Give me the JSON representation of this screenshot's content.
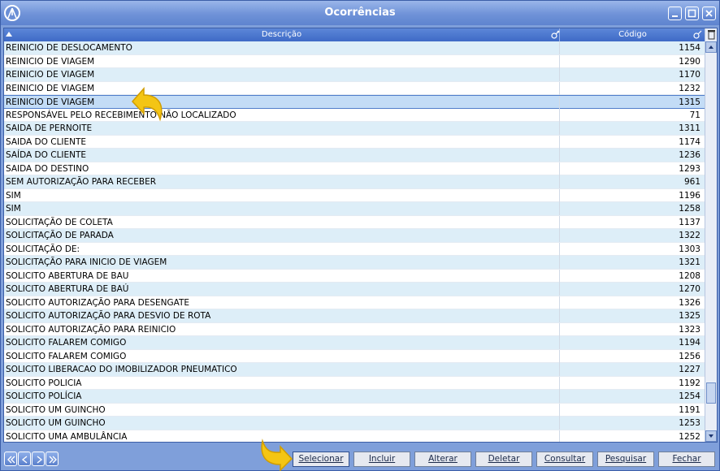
{
  "window": {
    "title": "Ocorrências",
    "controls": [
      "minimize",
      "maximize",
      "close"
    ]
  },
  "grid": {
    "columns": [
      "Descrição",
      "Código"
    ],
    "selected_index": 4,
    "rows": [
      {
        "descricao": "REINICIO DE DESLOCAMENTO",
        "codigo": "1154"
      },
      {
        "descricao": "REINICIO DE VIAGEM",
        "codigo": "1290"
      },
      {
        "descricao": "REINICIO DE VIAGEM",
        "codigo": "1170"
      },
      {
        "descricao": "REINICIO DE VIAGEM",
        "codigo": "1232"
      },
      {
        "descricao": "REINICIO DE VIAGEM",
        "codigo": "1315"
      },
      {
        "descricao": "RESPONSÁVEL PELO RECEBIMENTO NÃO LOCALIZADO",
        "codigo": "71"
      },
      {
        "descricao": "SAIDA DE PERNOITE",
        "codigo": "1311"
      },
      {
        "descricao": "SAIDA DO CLIENTE",
        "codigo": "1174"
      },
      {
        "descricao": "SAÍDA DO CLIENTE",
        "codigo": "1236"
      },
      {
        "descricao": "SAIDA DO DESTINO",
        "codigo": "1293"
      },
      {
        "descricao": "SEM AUTORIZAÇÃO PARA RECEBER",
        "codigo": "961"
      },
      {
        "descricao": "SIM",
        "codigo": "1196"
      },
      {
        "descricao": "SIM",
        "codigo": "1258"
      },
      {
        "descricao": "SOLICITAÇÃO DE COLETA",
        "codigo": "1137"
      },
      {
        "descricao": "SOLICITAÇÃO DE PARADA",
        "codigo": "1322"
      },
      {
        "descricao": "SOLICITAÇÃO DE:",
        "codigo": "1303"
      },
      {
        "descricao": "SOLICITAÇÃO PARA INICIO DE VIAGEM",
        "codigo": "1321"
      },
      {
        "descricao": "SOLICITO ABERTURA DE BAU",
        "codigo": "1208"
      },
      {
        "descricao": "SOLICITO ABERTURA DE BAÚ",
        "codigo": "1270"
      },
      {
        "descricao": "SOLICITO AUTORIZAÇÃO PARA DESENGATE",
        "codigo": "1326"
      },
      {
        "descricao": "SOLICITO AUTORIZAÇÃO PARA DESVIO DE ROTA",
        "codigo": "1325"
      },
      {
        "descricao": "SOLICITO AUTORIZAÇÃO PARA REINICIO",
        "codigo": "1323"
      },
      {
        "descricao": "SOLICITO FALAREM COMIGO",
        "codigo": "1194"
      },
      {
        "descricao": "SOLICITO FALAREM COMIGO",
        "codigo": "1256"
      },
      {
        "descricao": "SOLICITO LIBERACAO DO IMOBILIZADOR PNEUMATICO",
        "codigo": "1227"
      },
      {
        "descricao": "SOLICITO POLICIA",
        "codigo": "1192"
      },
      {
        "descricao": "SOLICITO POLÍCIA",
        "codigo": "1254"
      },
      {
        "descricao": "SOLICITO UM GUINCHO",
        "codigo": "1191"
      },
      {
        "descricao": "SOLICITO UM GUINCHO",
        "codigo": "1253"
      },
      {
        "descricao": "SOLICITO UMA AMBULÂNCIA",
        "codigo": "1252"
      }
    ]
  },
  "navigation": [
    "first",
    "previous",
    "next",
    "last"
  ],
  "actions": {
    "selecionar": "Selecionar",
    "incluir": "Incluir",
    "alterar": "Alterar",
    "deletar": "Deletar",
    "consultar": "Consultar",
    "pesquisar": "Pesquisar",
    "fechar": "Fechar"
  },
  "colors": {
    "titlebar": "#6f92d8",
    "window_bg": "#7f9fda",
    "header": "#4a76cc",
    "row_alt": "#ddeef8",
    "selected": "#c3dcf6",
    "pointer": "#f2c10d"
  }
}
